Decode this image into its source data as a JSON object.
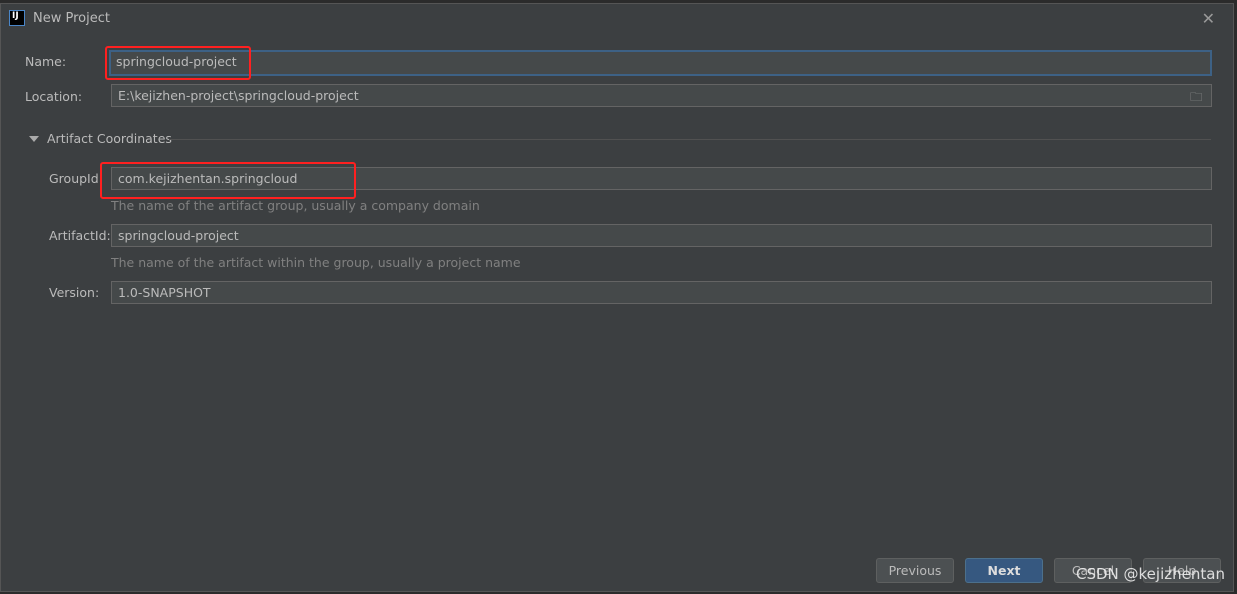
{
  "window": {
    "title": "New Project",
    "logo": "IJ"
  },
  "form": {
    "name_label": "Name:",
    "name_value": "springcloud-project",
    "location_label": "Location:",
    "location_value": "E:\\kejizhen-project\\springcloud-project",
    "section_title": "Artifact Coordinates",
    "groupid_label": "GroupId:",
    "groupid_value": "com.kejizhentan.springcloud",
    "groupid_hint": "The name of the artifact group, usually a company domain",
    "artifactid_label": "ArtifactId:",
    "artifactid_value": "springcloud-project",
    "artifactid_hint": "The name of the artifact within the group, usually a project name",
    "version_label": "Version:",
    "version_value": "1.0-SNAPSHOT"
  },
  "buttons": {
    "previous": "Previous",
    "next": "Next",
    "cancel": "Cancel",
    "help": "Help"
  },
  "watermark": "CSDN @kejizhentan",
  "colors": {
    "highlight": "#ff2020",
    "primary": "#365880"
  }
}
